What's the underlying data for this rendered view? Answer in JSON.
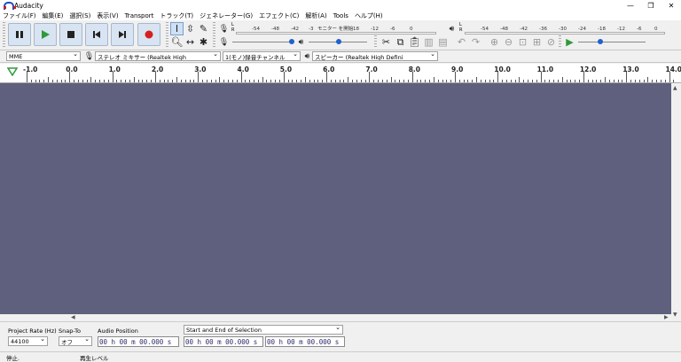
{
  "window": {
    "title": "Audacity",
    "min_glyph": "—",
    "max_glyph": "❐",
    "close_glyph": "✕"
  },
  "menu": [
    "ファイル(F)",
    "編集(E)",
    "選択(S)",
    "表示(V)",
    "Transport",
    "トラック(T)",
    "ジェネレーター(G)",
    "エフェクト(C)",
    "解析(A)",
    "Tools",
    "ヘルプ(H)"
  ],
  "record_meter": {
    "channels": [
      "L",
      "R"
    ],
    "ticks": [
      "-54",
      "-48",
      "-42",
      "-3",
      "モニター を開始",
      "-18",
      "-12",
      "-6",
      "0"
    ]
  },
  "play_meter": {
    "channels": [
      "L",
      "R"
    ],
    "ticks": [
      "-54",
      "-48",
      "-42",
      "-36",
      "-30",
      "-24",
      "-18",
      "-12",
      "-6",
      "0"
    ]
  },
  "devices": {
    "host": "MME",
    "recording_device": "ステレオ ミキサー (Realtek High",
    "channels": "1(モノ)録音チャンネル",
    "playback_device": "スピーカー (Realtek High Defini"
  },
  "ruler": {
    "labels": [
      "-1.0",
      "0.0",
      "1.0",
      "2.0",
      "3.0",
      "4.0",
      "5.0",
      "6.0",
      "7.0",
      "8.0",
      "9.0",
      "10.0",
      "11.0",
      "12.0",
      "13.0",
      "14.0"
    ],
    "range": [
      -1.0,
      14.0
    ]
  },
  "selection_toolbar": {
    "project_rate_label": "Project Rate (Hz)",
    "project_rate_value": "44100",
    "snap_to_label": "Snap-To",
    "snap_to_value": "オフ",
    "audio_position_label": "Audio Position",
    "audio_position_value": "00 h 00 m 00.000 s",
    "selection_label": "Start and End of Selection",
    "selection_start": "00 h 00 m 00.000 s",
    "selection_end": "00 h 00 m 00.000 s"
  },
  "status": {
    "state": "停止.",
    "playback_level": "再生レベル"
  },
  "colors": {
    "track_background": "#5f607e",
    "record_red": "#d42020",
    "play_green": "#2e9a3a"
  }
}
